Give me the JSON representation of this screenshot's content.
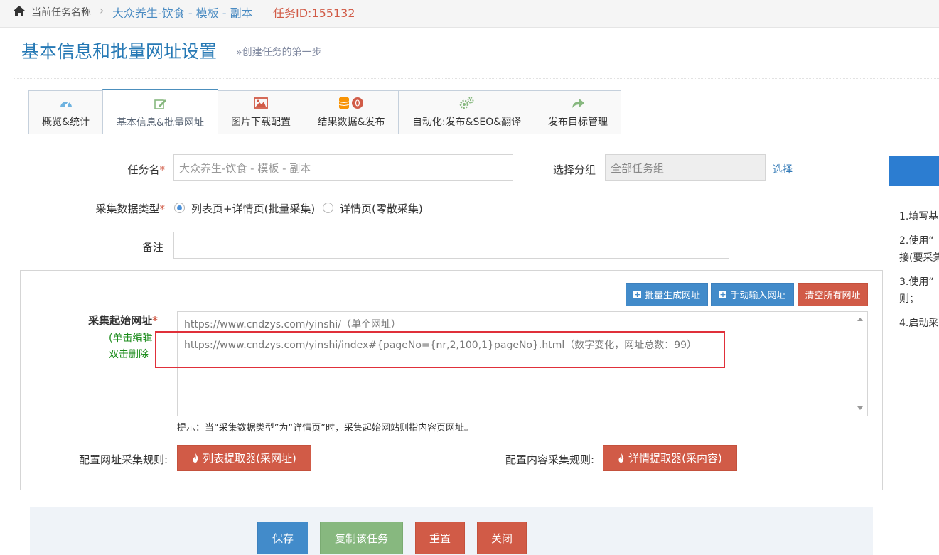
{
  "breadcrumb": {
    "label": "当前任务名称",
    "separator": "›",
    "task_name": "大众养生-饮食 - 模板 - 副本",
    "task_id": "任务ID:155132"
  },
  "page": {
    "title": "基本信息和批量网址设置",
    "subtitle": "»创建任务的第一步"
  },
  "tabs": [
    {
      "label": "概览&统计",
      "icon": "dashboard-icon",
      "active": false
    },
    {
      "label": "基本信息&批量网址",
      "icon": "edit-icon",
      "active": true
    },
    {
      "label": "图片下载配置",
      "icon": "picture-icon",
      "active": false
    },
    {
      "label": "结果数据&发布",
      "icon": "database-icon",
      "badge": "0",
      "active": false
    },
    {
      "label": "自动化:发布&SEO&翻译",
      "icon": "cogs-icon",
      "active": false
    },
    {
      "label": "发布目标管理",
      "icon": "share-icon",
      "active": false
    }
  ],
  "form": {
    "task_name_label": "任务名",
    "required_mark": "*",
    "task_name_placeholder": "大众养生-饮食 - 模板 - 副本",
    "group_label": "选择分组",
    "group_value": "全部任务组",
    "group_select_link": "选择",
    "data_type_label": "采集数据类型",
    "data_type_options": [
      "列表页+详情页(批量采集)",
      "详情页(零散采集)"
    ],
    "data_type_selected": 0,
    "remark_label": "备注",
    "remark_value": ""
  },
  "url_panel": {
    "buttons": {
      "batch_generate": "批量生成网址",
      "manual_input": "手动输入网址",
      "clear_all": "清空所有网址"
    },
    "start_url_label": "采集起始网址",
    "note_click_edit": "(单击编辑",
    "note_dblclick_delete": "双击删除",
    "urls": [
      "https://www.cndzys.com/yinshi/（单个网址）",
      "https://www.cndzys.com/yinshi/index#{pageNo={nr,2,100,1}pageNo}.html（数字变化，网址总数：99）"
    ],
    "hint": "提示：当“采集数据类型”为“详情页”时，采集起始网站则指内容页网址。",
    "list_rule_label": "配置网址采集规则:",
    "list_extractor_button": "列表提取器(采网址)",
    "content_rule_label": "配置内容采集规则:",
    "detail_extractor_button": "详情提取器(采内容)"
  },
  "footer": {
    "save": "保存",
    "copy_task": "复制该任务",
    "reset": "重置",
    "close": "关闭"
  },
  "help_panel": {
    "lines": [
      "1.填写基",
      "2.使用“",
      "接(要采集",
      "3.使用“",
      "则；",
      "4.启动采"
    ]
  },
  "colors": {
    "primary_blue": "#428bca",
    "danger_red": "#d15b47",
    "success_green": "#87b87f",
    "title_blue": "#2679b5",
    "highlight_red": "#e0303a"
  }
}
